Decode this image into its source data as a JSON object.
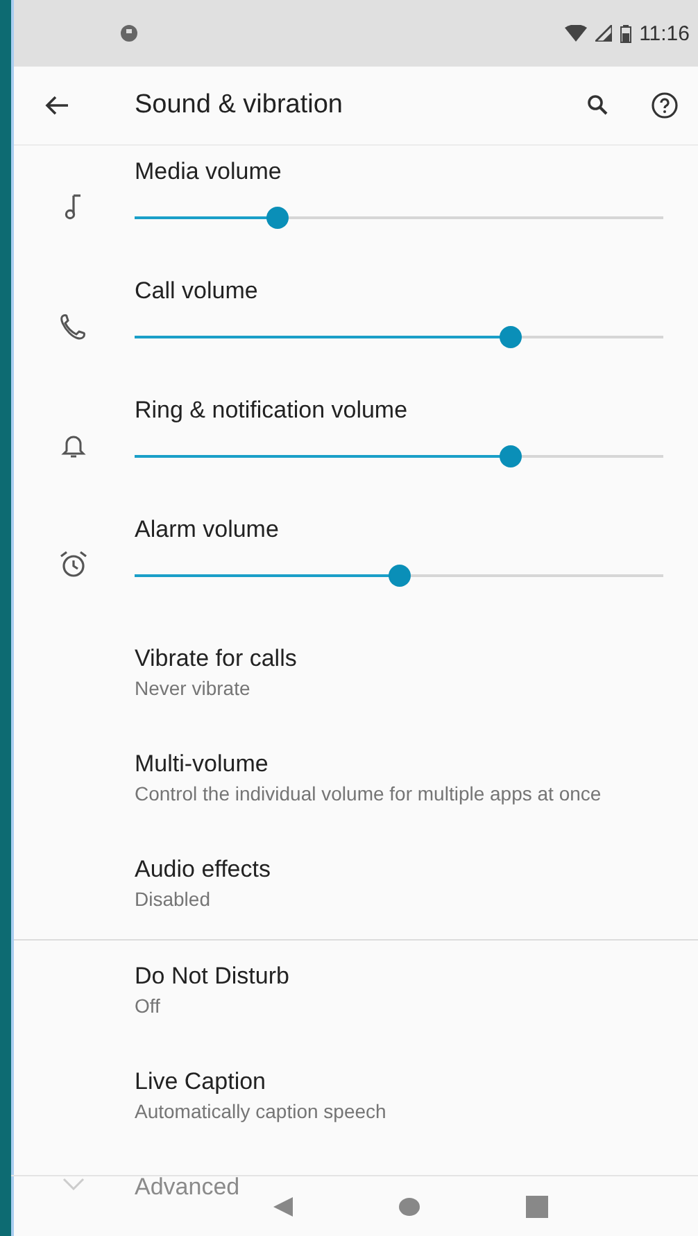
{
  "status_bar": {
    "time": "11:16"
  },
  "toolbar": {
    "title": "Sound & vibration"
  },
  "volume_sliders": [
    {
      "label": "Media volume",
      "level": 0.27
    },
    {
      "label": "Call volume",
      "level": 0.71
    },
    {
      "label": "Ring & notification volume",
      "level": 0.71
    },
    {
      "label": "Alarm volume",
      "level": 0.5
    }
  ],
  "settings": [
    {
      "title": "Vibrate for calls",
      "summary": "Never vibrate"
    },
    {
      "title": "Multi-volume",
      "summary": "Control the individual volume for multiple apps at once"
    },
    {
      "title": "Audio effects",
      "summary": "Disabled"
    }
  ],
  "more_settings": [
    {
      "title": "Do Not Disturb",
      "summary": "Off"
    },
    {
      "title": "Live Caption",
      "summary": "Automatically caption speech"
    }
  ],
  "advanced": {
    "title": "Advanced"
  }
}
